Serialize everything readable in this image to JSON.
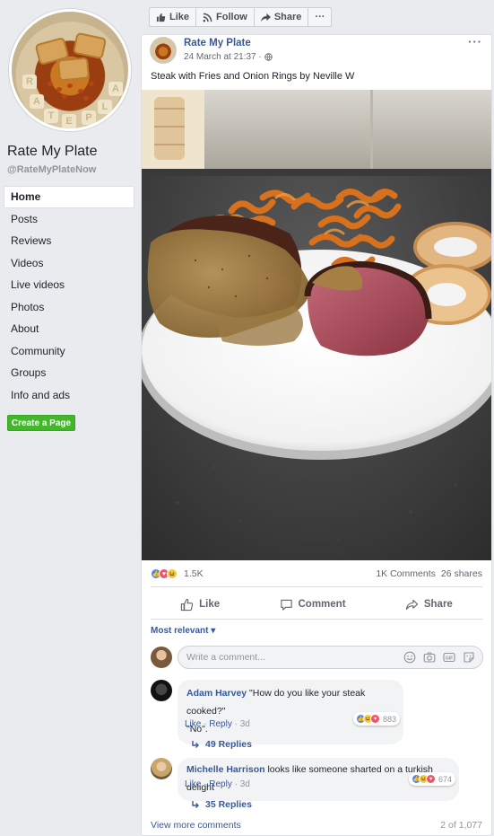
{
  "page": {
    "name": "Rate My Plate",
    "handle": "@RateMyPlateNow"
  },
  "nav": {
    "items": [
      {
        "label": "Home",
        "active": true
      },
      {
        "label": "Posts"
      },
      {
        "label": "Reviews"
      },
      {
        "label": "Videos"
      },
      {
        "label": "Live videos"
      },
      {
        "label": "Photos"
      },
      {
        "label": "About"
      },
      {
        "label": "Community"
      },
      {
        "label": "Groups"
      },
      {
        "label": "Info and ads"
      }
    ],
    "create_page": "Create a Page"
  },
  "top_actions": {
    "like": "Like",
    "follow": "Follow",
    "share": "Share",
    "more": "···"
  },
  "post": {
    "author": "Rate My Plate",
    "timestamp": "24 March at 21:37 ·",
    "more": "···",
    "text": "Steak with Fries and Onion Rings by Neville W",
    "reaction_count": "1.5K",
    "comments_count": "1K Comments",
    "shares_count": "26 shares",
    "actions": {
      "like": "Like",
      "comment": "Comment",
      "share": "Share"
    },
    "sort_label": "Most relevant ▾",
    "comment_placeholder": "Write a comment..."
  },
  "comments": [
    {
      "author": "Adam Harvey",
      "text": "\"How do you like your steak cooked?\"",
      "text2": "\"No\".",
      "like": "Like",
      "reply": "Reply",
      "age": "3d",
      "reactions": "883",
      "replies": "49 Replies"
    },
    {
      "author": "Michelle Harrison",
      "text": "looks like someone sharted on a turkish delight",
      "like": "Like",
      "reply": "Reply",
      "age": "3d",
      "reactions": "674",
      "replies": "35 Replies"
    }
  ],
  "footer": {
    "view_more": "View more comments",
    "count": "2 of 1,077"
  },
  "colors": {
    "link": "#385898",
    "create_page_green": "#42b72a",
    "like_blue": "#4b87f2",
    "love_red": "#f25268",
    "haha_yellow": "#f7c845"
  }
}
